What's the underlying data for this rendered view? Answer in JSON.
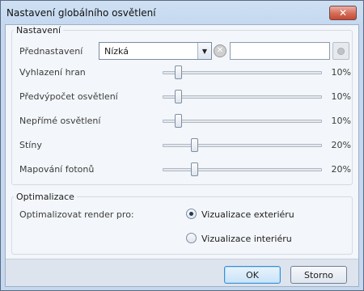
{
  "window": {
    "title": "Nastavení globálního osvětlení",
    "close_label": "✕"
  },
  "settings": {
    "group_label": "Nastavení",
    "preset": {
      "label": "Přednastavení",
      "value": "Nízká",
      "name_value": ""
    },
    "sliders": [
      {
        "label": "Vyhlazení hran",
        "value": 0.1,
        "value_text": "10%"
      },
      {
        "label": "Předvýpočet osvětlení",
        "value": 0.1,
        "value_text": "10%"
      },
      {
        "label": "Nepřímé osvětlení",
        "value": 0.1,
        "value_text": "10%"
      },
      {
        "label": "Stíny",
        "value": 0.2,
        "value_text": "20%"
      },
      {
        "label": "Mapování fotonů",
        "value": 0.2,
        "value_text": "20%"
      }
    ]
  },
  "optimization": {
    "group_label": "Optimalizace",
    "label": "Optimalizovat render pro:",
    "options": [
      {
        "label": "Vizualizace exteriéru",
        "selected": true
      },
      {
        "label": "Vizualizace interiéru",
        "selected": false
      }
    ]
  },
  "buttons": {
    "ok": "OK",
    "cancel": "Storno"
  }
}
